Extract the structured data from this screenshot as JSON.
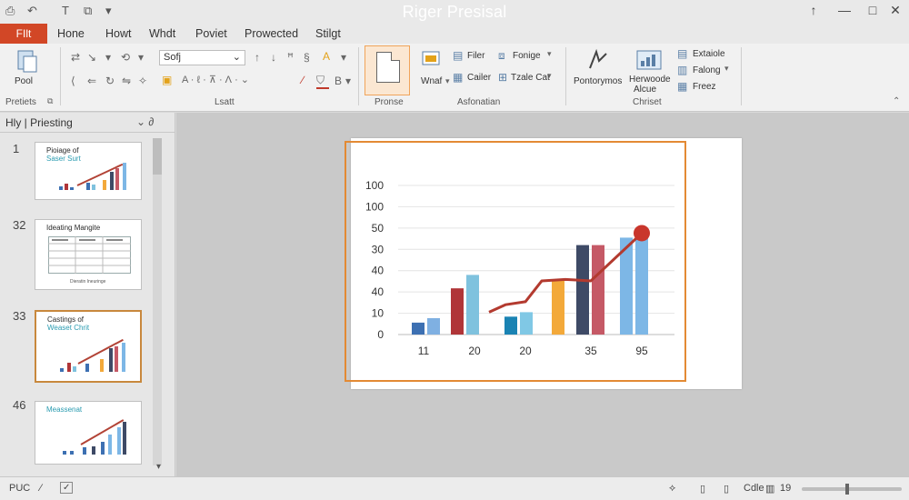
{
  "app": {
    "title": "Riger Presisal"
  },
  "quick_access": [
    "⎙",
    "↶",
    "T",
    "⧉",
    "▾"
  ],
  "window_controls": [
    "↑",
    "—",
    "□",
    "✕"
  ],
  "tabs": {
    "file": "FIlt",
    "items": [
      "Hone",
      "Howt",
      "Whdt",
      "Poviet",
      "Prowected",
      "Stilgt"
    ]
  },
  "ribbon": {
    "paste_label": "Pool",
    "left_group_label": "Pretiets",
    "font_value": "Sofj",
    "font_group_label": "Lsatt",
    "paste_group_label": "Pronse",
    "what_label": "Wnaf",
    "filer_label": "Filer",
    "cailer_label": "Cailer",
    "fontige_label": "Fonige",
    "tazle_label": "Tzale Cat",
    "automation_label": "Asfonatian",
    "pontorymos_label": "Pontorymos",
    "herwoode_label": "Herwoode",
    "alcue_label": "Alcue",
    "extaide_label": "Extaiole",
    "falong_label": "Falong",
    "freez_label": "Freez",
    "chriset_label": "Chriset"
  },
  "panel": {
    "title": "Hly | Priesting",
    "controls": "⌄ ∂",
    "slides": [
      {
        "num": "1",
        "title1": "Pioiage of",
        "title2": "Saser Surt",
        "kind": "chart",
        "selected": false
      },
      {
        "num": "32",
        "title1": "Ideating Mangite",
        "title2": "",
        "kind": "table",
        "selected": false
      },
      {
        "num": "33",
        "title1": "Castings of",
        "title2": "Weaset Chrit",
        "kind": "chart",
        "selected": true
      },
      {
        "num": "46",
        "title1": "Meassenat",
        "title2": "",
        "kind": "chart",
        "selected": false
      }
    ],
    "table_footer": "Dieratin Ineuringe"
  },
  "chart_data": {
    "type": "bar",
    "title": "",
    "xlabel": "",
    "ylabel": "",
    "y_tick_labels": [
      "100",
      "100",
      "50",
      "30",
      "40",
      "40",
      "10",
      "0"
    ],
    "x_labels": [
      "11",
      "20",
      "20",
      "35",
      "95"
    ],
    "ylim": [
      0,
      100
    ],
    "grid": true,
    "bars": [
      {
        "value": 8,
        "color": "#3d70b2"
      },
      {
        "value": 11,
        "color": "#7fb0e2"
      },
      {
        "value": 31,
        "color": "#b03538"
      },
      {
        "value": 40,
        "color": "#7fc2de"
      },
      {
        "value": 12,
        "color": "#1a83b3"
      },
      {
        "value": 15,
        "color": "#80c8e5"
      },
      {
        "value": 37,
        "color": "#f3a93a"
      },
      {
        "value": 60,
        "color": "#3e4a66"
      },
      {
        "value": 60,
        "color": "#c55966"
      },
      {
        "value": 65,
        "color": "#7db7e6"
      },
      {
        "value": 65,
        "color": "#7db7e6"
      }
    ],
    "line": {
      "color": "#b33a2f",
      "values": [
        15,
        20,
        22,
        36,
        37,
        36,
        60,
        68
      ]
    }
  },
  "status": {
    "left": "PUC",
    "right_label": "Cdle",
    "zoom": "19"
  }
}
